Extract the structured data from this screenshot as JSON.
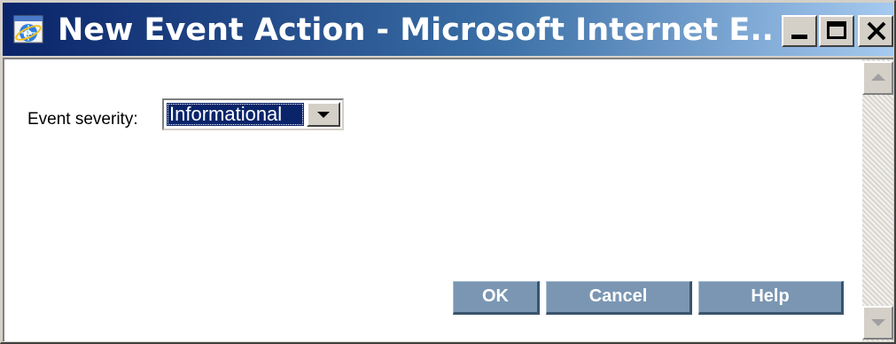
{
  "window": {
    "title": "New Event Action - Microsoft Internet E...",
    "icon": "internet-explorer-icon",
    "controls": {
      "minimize_icon": "minimize-icon",
      "maximize_icon": "maximize-icon",
      "close_icon": "close-icon"
    }
  },
  "form": {
    "severity_label": "Event severity:",
    "severity_selected": "Informational"
  },
  "buttons": {
    "ok_label": "OK",
    "cancel_label": "Cancel",
    "help_label": "Help"
  },
  "colors": {
    "title_bar_start": "#0a246a",
    "title_bar_end": "#a6caf0",
    "dialog_button": "#7a96b2",
    "selection": "#0a246a"
  }
}
